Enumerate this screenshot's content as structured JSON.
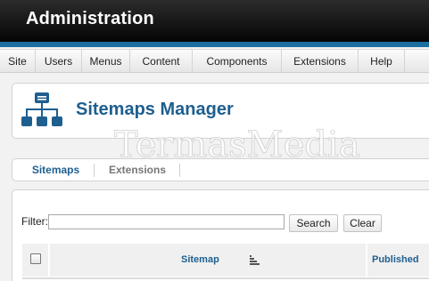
{
  "header": {
    "title": "Administration"
  },
  "menu": [
    {
      "label": "Site",
      "width": 40
    },
    {
      "label": "Users",
      "width": 52
    },
    {
      "label": "Menus",
      "width": 54
    },
    {
      "label": "Content",
      "width": 70
    },
    {
      "label": "Components",
      "width": 100
    },
    {
      "label": "Extensions",
      "width": 86
    },
    {
      "label": "Help",
      "width": 52
    }
  ],
  "page": {
    "title": "Sitemaps Manager",
    "icon": "sitemap-icon"
  },
  "watermark": "TermasMedia",
  "tabs": {
    "active": "Sitemaps",
    "other": "Extensions"
  },
  "filter": {
    "label": "Filter:",
    "value": "",
    "search_label": "Search",
    "clear_label": "Clear"
  },
  "table": {
    "columns": {
      "sitemap": "Sitemap",
      "published": "Published"
    },
    "sort_icon": "sort-ascending-icon"
  },
  "colors": {
    "brand_blue": "#1e5f8f",
    "header_bar": "#1a6fa0"
  }
}
